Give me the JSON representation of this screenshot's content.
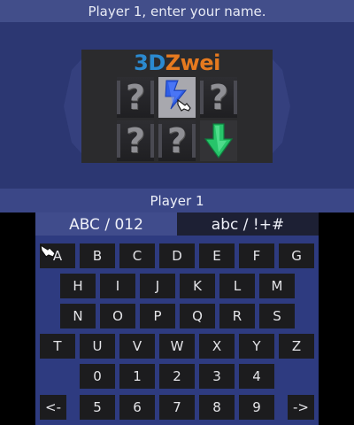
{
  "top_screen": {
    "prompt": "Player 1, enter your name.",
    "player_label": "Player 1",
    "logo": {
      "part1": "3D",
      "part2": "Zwei",
      "part1_color": "#2b8ad0",
      "part2_color": "#e67a1f"
    },
    "tiles": [
      {
        "name": "unknown-tile-1",
        "kind": "question",
        "label": "?"
      },
      {
        "name": "lightning-tile",
        "kind": "lightning-icon"
      },
      {
        "name": "unknown-tile-2",
        "kind": "question",
        "label": "?"
      },
      {
        "name": "unknown-tile-3",
        "kind": "question",
        "label": "?"
      },
      {
        "name": "unknown-tile-4",
        "kind": "question",
        "label": "?"
      },
      {
        "name": "down-arrow-tile",
        "kind": "green-down-arrow-icon"
      }
    ]
  },
  "keyboard": {
    "tabs": {
      "upper": "ABC / 012",
      "lower": "abc / !+#"
    },
    "keys": {
      "A": "A",
      "B": "B",
      "C": "C",
      "D": "D",
      "E": "E",
      "F": "F",
      "G": "G",
      "H": "H",
      "I": "I",
      "J": "J",
      "K": "K",
      "L": "L",
      "M": "M",
      "N": "N",
      "O": "O",
      "P": "P",
      "Q": "Q",
      "R": "R",
      "S": "S",
      "T": "T",
      "U": "U",
      "V": "V",
      "W": "W",
      "X": "X",
      "Y": "Y",
      "Z": "Z",
      "0": "0",
      "1": "1",
      "2": "2",
      "3": "3",
      "4": "4",
      "5": "5",
      "6": "6",
      "7": "7",
      "8": "8",
      "9": "9",
      "backspace": "<-",
      "forward": "->"
    },
    "cursor_icon": "hand-pointer-icon"
  },
  "colors": {
    "top_background": "#2c3772",
    "panel_background": "#2e3b80",
    "key_background": "#1c1c1e",
    "arrow_green": "#2ecc71"
  }
}
